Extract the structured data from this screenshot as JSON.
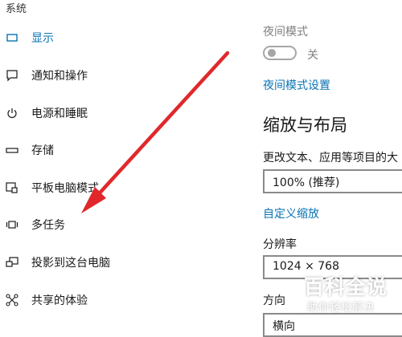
{
  "sidebar": {
    "header": "系统",
    "items": [
      {
        "label": "显示",
        "icon": "display-icon",
        "active": true
      },
      {
        "label": "通知和操作",
        "icon": "notification-icon"
      },
      {
        "label": "电源和睡眠",
        "icon": "power-icon"
      },
      {
        "label": "存储",
        "icon": "storage-icon"
      },
      {
        "label": "平板电脑模式",
        "icon": "tablet-mode-icon"
      },
      {
        "label": "多任务",
        "icon": "multitasking-icon"
      },
      {
        "label": "投影到这台电脑",
        "icon": "projecting-icon"
      },
      {
        "label": "共享的体验",
        "icon": "shared-experiences-icon"
      }
    ]
  },
  "main": {
    "night_light": {
      "title": "夜间模式",
      "state": "关",
      "settings_link": "夜间模式设置"
    },
    "scale_layout": {
      "heading": "缩放与布局",
      "text_size_label": "更改文本、应用等项目的大",
      "text_size_value": "100% (推荐)",
      "custom_scaling_link": "自定义缩放",
      "resolution_label": "分辨率",
      "resolution_value": "1024 × 768",
      "orientation_label": "方向",
      "orientation_value": "横向"
    }
  },
  "watermark": {
    "title": "百科全说",
    "subtitle": "助你轻松解决"
  },
  "colors": {
    "accent": "#0a72b4",
    "arrow": "#e0282c"
  }
}
